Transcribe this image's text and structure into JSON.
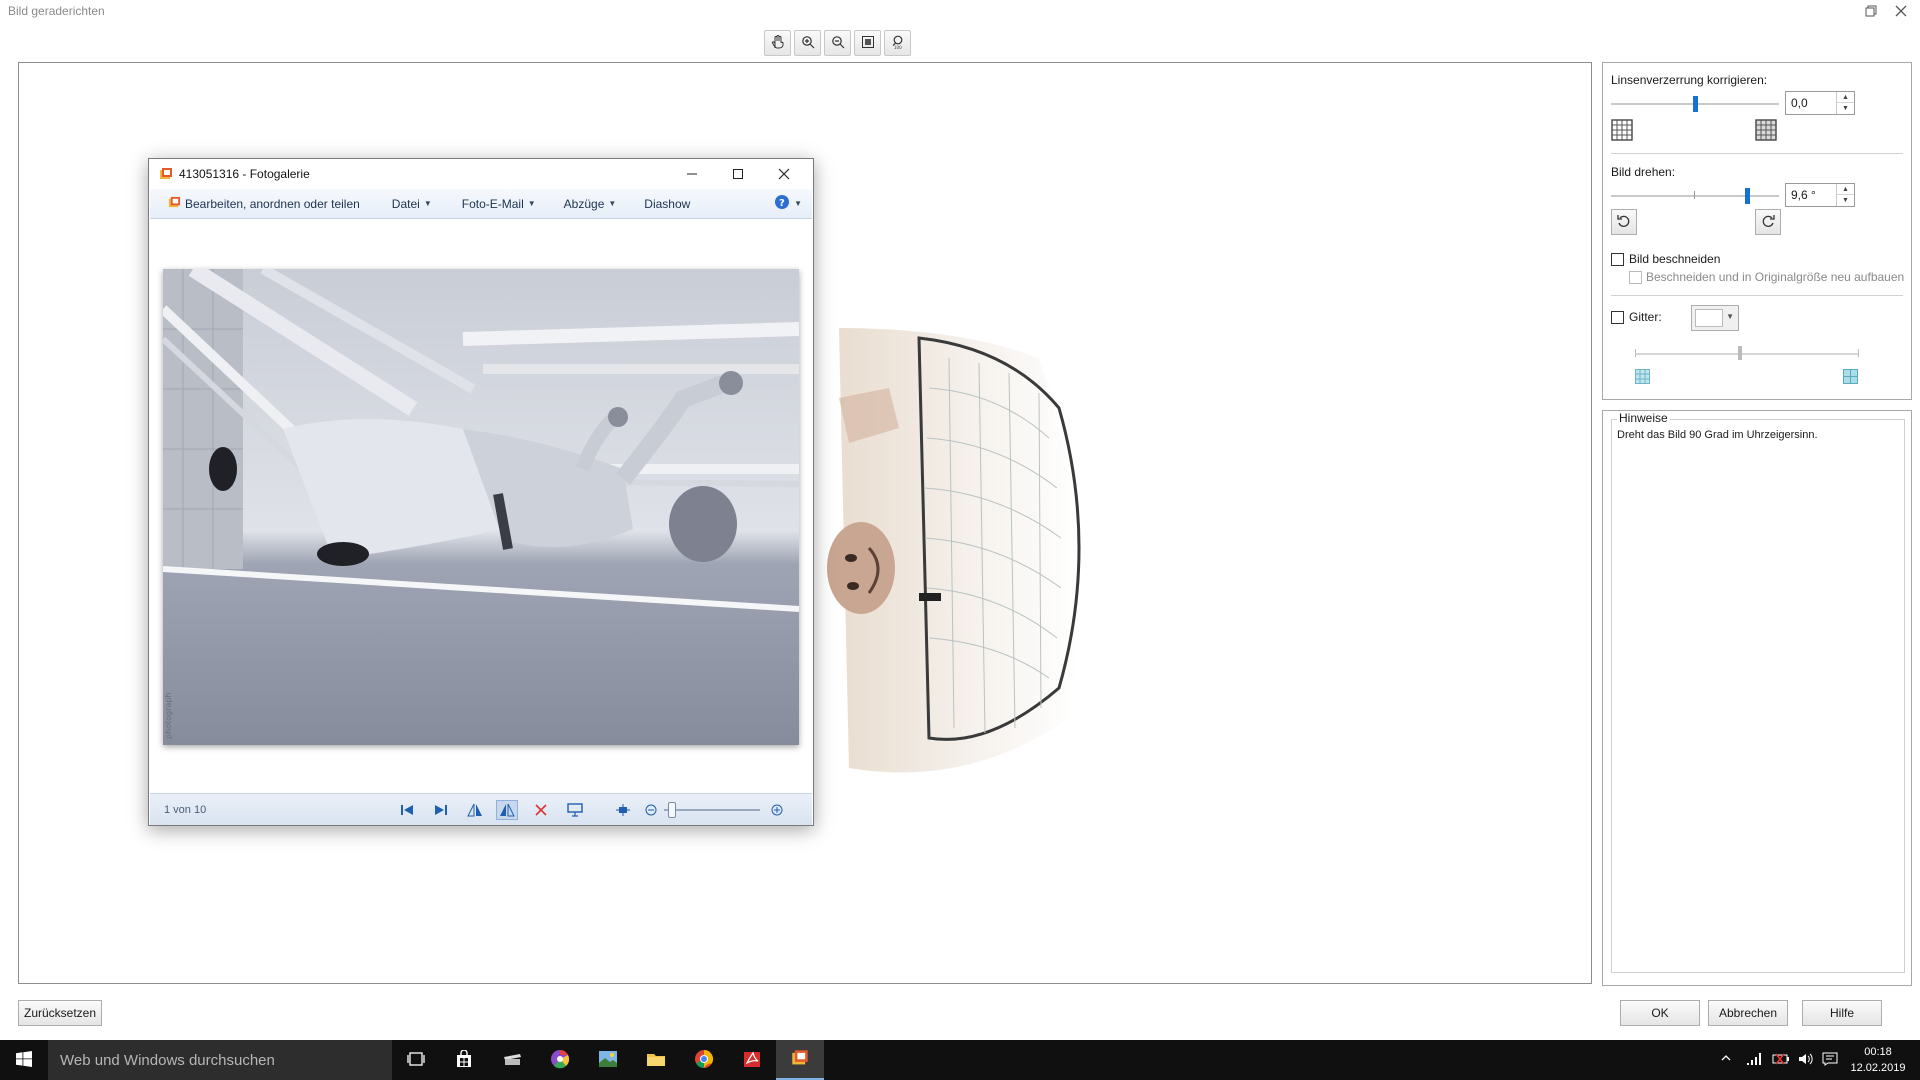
{
  "window": {
    "title": "Bild geraderichten"
  },
  "gallery": {
    "title": "413051316 - Fotogalerie",
    "menu": {
      "edit": "Bearbeiten, anordnen oder teilen",
      "file": "Datei",
      "email": "Foto-E-Mail",
      "prints": "Abzüge",
      "slideshow": "Diashow"
    },
    "status": "1 von 10",
    "watermark": "photograph"
  },
  "panel": {
    "lens_label": "Linsenverzerrung korrigieren:",
    "lens_value": "0,0",
    "lens_slider": 0.5,
    "rotate_label": "Bild drehen:",
    "rotate_value": "9,6 °",
    "rotate_slider": 0.82,
    "crop_label": "Bild beschneiden",
    "crop_sub_label": "Beschneiden und in Originalgröße neu aufbauen",
    "grid_label": "Gitter:",
    "grid_slider": 0.47
  },
  "hints": {
    "title": "Hinweise",
    "text": "Dreht das Bild 90 Grad im Uhrzeigersinn."
  },
  "buttons": {
    "reset": "Zurücksetzen",
    "ok": "OK",
    "cancel": "Abbrechen",
    "help": "Hilfe"
  },
  "taskbar": {
    "search_placeholder": "Web und Windows durchsuchen",
    "time": "00:18",
    "date": "12.02.2019"
  },
  "colors": {
    "accent": "#1671d4",
    "taskbar": "#101010"
  }
}
